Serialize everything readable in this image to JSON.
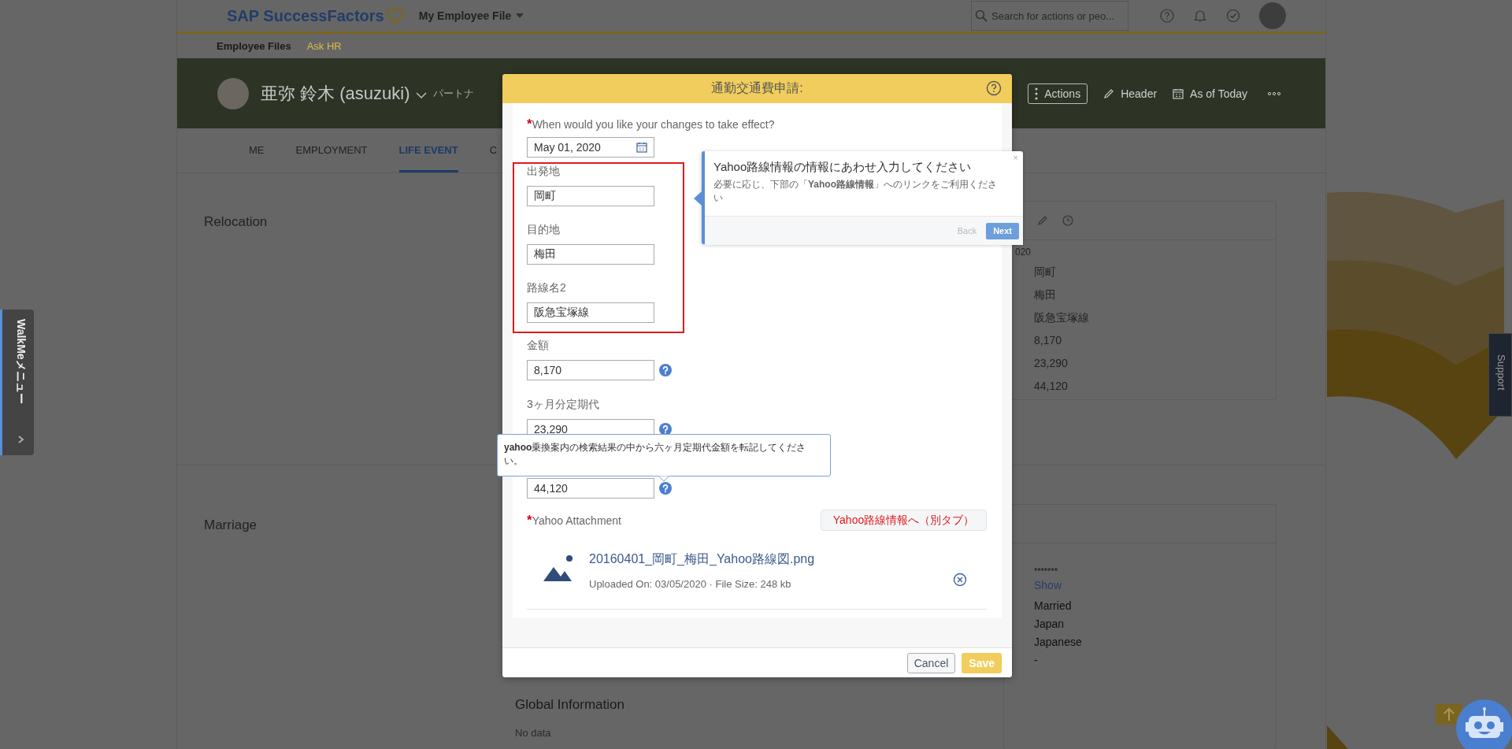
{
  "top_bar": {
    "logo": "SAP SuccessFactors",
    "menu": "My Employee File",
    "search_placeholder": "Search for actions or peo..."
  },
  "subnav": [
    {
      "label": "Employee Files",
      "selected": true
    },
    {
      "label": "Ask HR",
      "selected": false
    }
  ],
  "profile": {
    "name": "亜弥 鈴木 (asuzuki)",
    "role": "パートナ",
    "actions": [
      {
        "kind": "menu",
        "label": "Actions"
      },
      {
        "kind": "edit",
        "label": "Header"
      },
      {
        "kind": "calendar",
        "label": "As of Today"
      }
    ]
  },
  "tabs": [
    {
      "label": "ME",
      "selected": false
    },
    {
      "label": "EMPLOYMENT",
      "selected": false
    },
    {
      "label": "LIFE EVENT",
      "selected": true
    },
    {
      "label": "C",
      "selected": false
    }
  ],
  "relocation": {
    "title": "Relocation",
    "date": "020",
    "values": [
      "岡町",
      "梅田",
      "阪急宝塚線",
      "8,170",
      "23,290",
      "44,120"
    ]
  },
  "marriage": {
    "title": "Marriage",
    "rows": [
      {
        "kind": "masked",
        "value": "*******"
      },
      {
        "kind": "link",
        "value": "Show"
      },
      {
        "kind": "text",
        "value": "Married"
      },
      {
        "kind": "text",
        "value": "Japan"
      },
      {
        "kind": "text",
        "value": "Japanese"
      },
      {
        "kind": "text",
        "value": "-"
      }
    ]
  },
  "global_information": {
    "title": "Global Information",
    "text": "No data"
  },
  "walkme": {
    "label": "WalkMeメニュー"
  },
  "support": {
    "label": "Support"
  },
  "modal": {
    "title": "通勤交通費申請:",
    "effective_date": {
      "required_mark": "*",
      "label": "When would you like your changes to take effect?",
      "value": "May 01, 2020"
    },
    "fields": [
      {
        "label": "出発地",
        "value": "岡町",
        "highlighted": true,
        "help": false
      },
      {
        "label": "目的地",
        "value": "梅田",
        "highlighted": true,
        "help": false
      },
      {
        "label": "路線名2",
        "value": "阪急宝塚線",
        "highlighted": true,
        "help": false
      },
      {
        "label": "金額",
        "value": "8,170",
        "highlighted": false,
        "help": true
      },
      {
        "label": "3ヶ月分定期代",
        "value": "23,290",
        "highlighted": false,
        "help": true
      },
      {
        "value": "44,120",
        "highlighted": false,
        "help": true
      }
    ],
    "attachment": {
      "required_mark": "*",
      "label": "Yahoo Attachment",
      "link_button": "Yahoo路線情報へ（別タブ）",
      "file_name": "20160401_岡町_梅田_Yahoo路線図.png",
      "file_info": "Uploaded On: 03/05/2020 · File Size: 248 kb"
    },
    "buttons": [
      {
        "kind": "secondary",
        "label": "Cancel"
      },
      {
        "kind": "primary",
        "label": "Save"
      }
    ]
  },
  "walkthrough": {
    "title": "Yahoo路線情報の情報にあわせ入力してください",
    "body": "必要に応じ、下部の「**Yahoo路線情報**」へのリンクをご利用ください",
    "back": "Back",
    "next": "Next",
    "close": "×"
  },
  "help_tooltip": {
    "text": "**yahoo**乗換案内の検索結果の中から六ヶ月定期代金額を転記してください。"
  }
}
